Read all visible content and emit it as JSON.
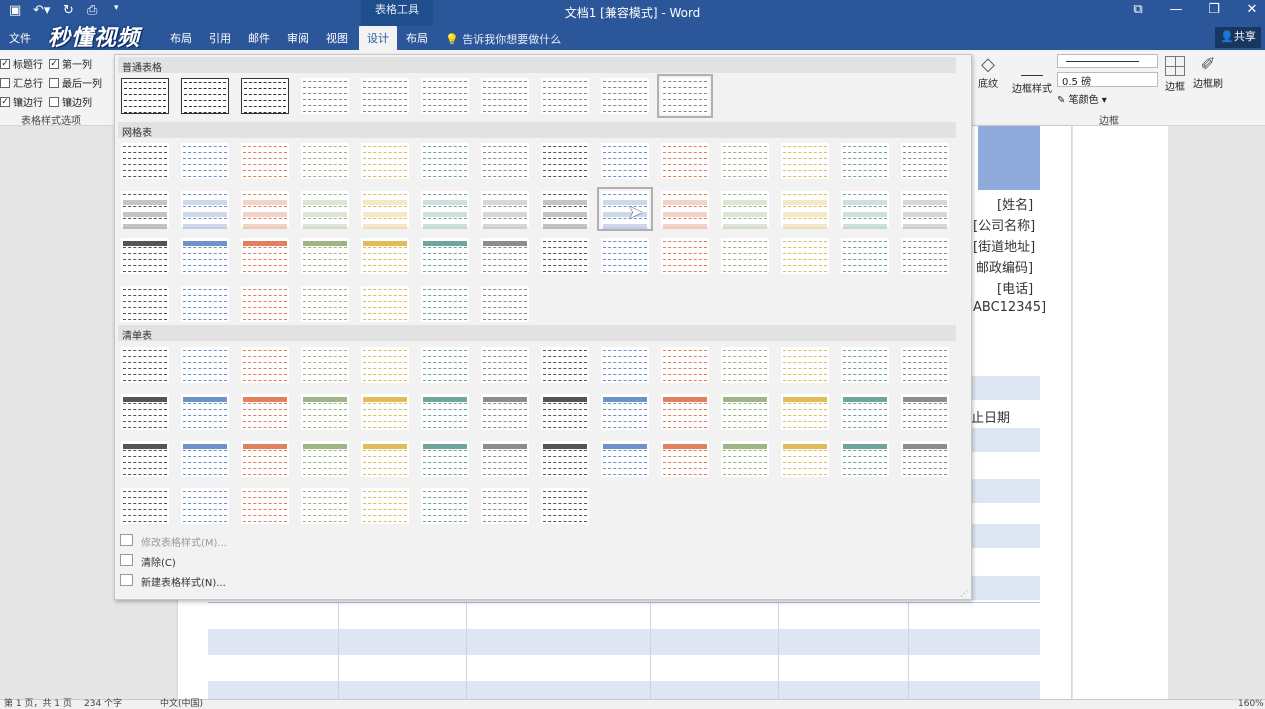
{
  "window": {
    "title": "文档1 [兼容模式] - Word",
    "table_tools": "表格工具"
  },
  "logo": "秒懂视频",
  "tabs": [
    {
      "label": "文件",
      "active": false
    },
    {
      "label": "布局",
      "active": false
    },
    {
      "label": "引用",
      "active": false
    },
    {
      "label": "邮件",
      "active": false
    },
    {
      "label": "审阅",
      "active": false
    },
    {
      "label": "视图",
      "active": false
    },
    {
      "label": "设计",
      "active": true
    },
    {
      "label": "布局",
      "active": false
    }
  ],
  "tell_me": "告诉我你想要做什么",
  "share": "共享",
  "options": {
    "header_row": "标题行",
    "first_col": "第一列",
    "total_row": "汇总行",
    "last_col": "最后一列",
    "banded_rows": "镶边行",
    "banded_cols": "镶边列",
    "group_label": "表格样式选项"
  },
  "options_checked": {
    "header_row": true,
    "first_col": true,
    "total_row": false,
    "last_col": false,
    "banded_rows": true,
    "banded_cols": false
  },
  "borders": {
    "shading": "底纹",
    "border_styles": "边框样式",
    "weight": "0.5 磅",
    "pen_color": "笔颜色",
    "borders": "边框",
    "painter": "边框刷",
    "group_label": "边框"
  },
  "gallery": {
    "plain": "普通表格",
    "grid": "网格表",
    "list": "清单表",
    "modify": "修改表格样式(M)...",
    "clear": "清除(C)",
    "new_style": "新建表格样式(N)..."
  },
  "doc_fields": [
    "[姓名]",
    "[公司名称]",
    "[街道地址]",
    "邮政编码]",
    "[电话]",
    "ABC12345]",
    "止日期"
  ],
  "status": {
    "page": "第 1 页，共 1 页",
    "words": "234 个字",
    "lang": "中文(中国)",
    "zoom": "160%"
  },
  "colors": {
    "ribbon_blue": "#2b579a",
    "accent": [
      "#555555",
      "#6f93c6",
      "#e0805e",
      "#9fb585",
      "#e0bd5a",
      "#6fa59d",
      "#8c8c8c"
    ]
  }
}
